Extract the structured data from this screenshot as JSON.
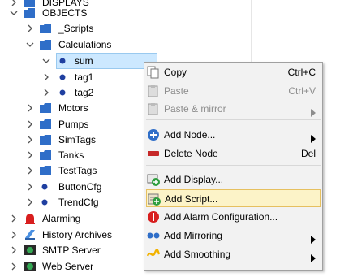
{
  "tree": {
    "items": [
      {
        "label": "DISPLAYS"
      },
      {
        "label": "OBJECTS"
      },
      {
        "label": "_Scripts"
      },
      {
        "label": "Calculations"
      },
      {
        "label": "sum"
      },
      {
        "label": "tag1"
      },
      {
        "label": "tag2"
      },
      {
        "label": "Motors"
      },
      {
        "label": "Pumps"
      },
      {
        "label": "SimTags"
      },
      {
        "label": "Tanks"
      },
      {
        "label": "TestTags"
      },
      {
        "label": "ButtonCfg"
      },
      {
        "label": "TrendCfg"
      },
      {
        "label": "Alarming"
      },
      {
        "label": "History Archives"
      },
      {
        "label": "SMTP Server"
      },
      {
        "label": "Web Server"
      }
    ]
  },
  "context_menu": {
    "items": [
      {
        "label": "Copy",
        "shortcut": "Ctrl+C",
        "enabled": true,
        "icon": "copy-icon"
      },
      {
        "label": "Paste",
        "shortcut": "Ctrl+V",
        "enabled": false,
        "icon": "paste-icon"
      },
      {
        "label": "Paste & mirror",
        "enabled": false,
        "icon": "paste-mirror-icon",
        "submenu": true
      },
      {
        "label": "Add Node...",
        "enabled": true,
        "icon": "add-node-icon",
        "submenu": true
      },
      {
        "label": "Delete Node",
        "shortcut": "Del",
        "enabled": true,
        "icon": "delete-icon"
      },
      {
        "label": "Add Display...",
        "enabled": true,
        "icon": "add-display-icon"
      },
      {
        "label": "Add Script...",
        "enabled": true,
        "icon": "add-script-icon",
        "highlighted": true
      },
      {
        "label": "Add Alarm Configuration...",
        "enabled": true,
        "icon": "alarm-config-icon"
      },
      {
        "label": "Add Mirroring",
        "enabled": true,
        "icon": "mirroring-icon",
        "submenu": true
      },
      {
        "label": "Add Smoothing",
        "enabled": true,
        "icon": "smoothing-icon",
        "submenu": true
      }
    ]
  },
  "colors": {
    "folder": "#2f6ec8",
    "selection_bg": "#cce8ff",
    "menu_bg": "#f2f2f2",
    "menu_highlight": "#fcf3c8",
    "tag_bullet": "#1f3fa0",
    "alarm_red": "#d81e1e"
  }
}
